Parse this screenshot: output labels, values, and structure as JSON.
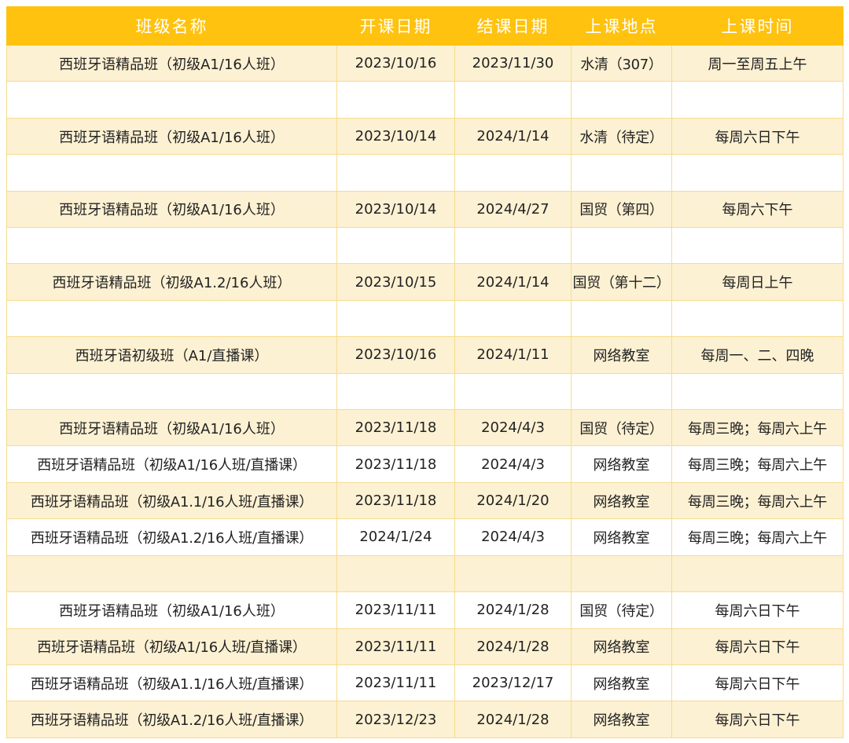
{
  "columns": {
    "name": "班级名称",
    "start": "开课日期",
    "end": "结课日期",
    "location": "上课地点",
    "time": "上课时间"
  },
  "rows": [
    {
      "name": "西班牙语精品班（初级A1/16人班）",
      "start": "2023/10/16",
      "end": "2023/11/30",
      "location": "水清（307）",
      "time": "周一至周五上午"
    },
    {
      "name": "",
      "start": "",
      "end": "",
      "location": "",
      "time": ""
    },
    {
      "name": "西班牙语精品班（初级A1/16人班）",
      "start": "2023/10/14",
      "end": "2024/1/14",
      "location": "水清（待定）",
      "time": "每周六日下午"
    },
    {
      "name": "",
      "start": "",
      "end": "",
      "location": "",
      "time": ""
    },
    {
      "name": "西班牙语精品班（初级A1/16人班）",
      "start": "2023/10/14",
      "end": "2024/4/27",
      "location": "国贸（第四）",
      "time": "每周六下午"
    },
    {
      "name": "",
      "start": "",
      "end": "",
      "location": "",
      "time": ""
    },
    {
      "name": "西班牙语精品班（初级A1.2/16人班）",
      "start": "2023/10/15",
      "end": "2024/1/14",
      "location": "国贸（第十二）",
      "time": "每周日上午"
    },
    {
      "name": "",
      "start": "",
      "end": "",
      "location": "",
      "time": ""
    },
    {
      "name": "西班牙语初级班（A1/直播课）",
      "start": "2023/10/16",
      "end": "2024/1/11",
      "location": "网络教室",
      "time": "每周一、二、四晚"
    },
    {
      "name": "",
      "start": "",
      "end": "",
      "location": "",
      "time": ""
    },
    {
      "name": "西班牙语精品班（初级A1/16人班）",
      "start": "2023/11/18",
      "end": "2024/4/3",
      "location": "国贸（待定）",
      "time": "每周三晚；每周六上午"
    },
    {
      "name": "西班牙语精品班（初级A1/16人班/直播课）",
      "start": "2023/11/18",
      "end": "2024/4/3",
      "location": "网络教室",
      "time": "每周三晚；每周六上午"
    },
    {
      "name": "西班牙语精品班（初级A1.1/16人班/直播课）",
      "start": "2023/11/18",
      "end": "2024/1/20",
      "location": "网络教室",
      "time": "每周三晚；每周六上午"
    },
    {
      "name": "西班牙语精品班（初级A1.2/16人班/直播课）",
      "start": "2024/1/24",
      "end": "2024/4/3",
      "location": "网络教室",
      "time": "每周三晚；每周六上午"
    },
    {
      "name": "",
      "start": "",
      "end": "",
      "location": "",
      "time": ""
    },
    {
      "name": "西班牙语精品班（初级A1/16人班）",
      "start": "2023/11/11",
      "end": "2024/1/28",
      "location": "国贸（待定）",
      "time": "每周六日下午"
    },
    {
      "name": "西班牙语精品班（初级A1/16人班/直播课）",
      "start": "2023/11/11",
      "end": "2024/1/28",
      "location": "网络教室",
      "time": "每周六日下午"
    },
    {
      "name": "西班牙语精品班（初级A1.1/16人班/直播课）",
      "start": "2023/11/11",
      "end": "2023/12/17",
      "location": "网络教室",
      "time": "每周六日下午"
    },
    {
      "name": "西班牙语精品班（初级A1.2/16人班/直播课）",
      "start": "2023/12/23",
      "end": "2024/1/28",
      "location": "网络教室",
      "time": "每周六日下午"
    }
  ],
  "colors": {
    "header_bg": "#ffc20e",
    "header_text": "#ffffff",
    "row_shade": "#fdf1d3",
    "row_plain": "#ffffff",
    "grid_line": "#f6dc8e"
  }
}
